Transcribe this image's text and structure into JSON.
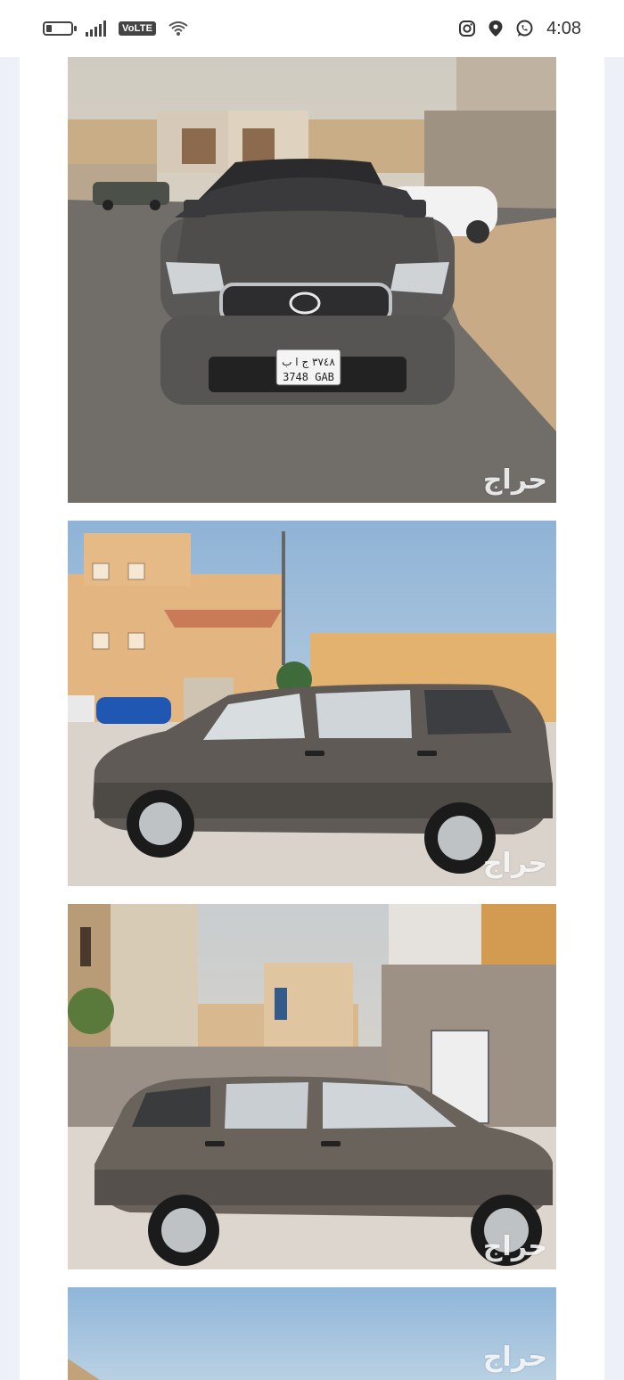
{
  "status_bar": {
    "network_badge": "VoLTE",
    "time": "4:08",
    "icons": [
      "battery-icon",
      "signal-icon",
      "wifi-icon",
      "instagram-icon",
      "location-icon",
      "whatsapp-icon"
    ]
  },
  "listing": {
    "photos": [
      {
        "name": "front-view",
        "watermark": "حراج",
        "plate_arabic": "٣٧٤٨ ج ا ب",
        "plate_latin": "3748 GAB"
      },
      {
        "name": "side-view-left",
        "watermark": "حراج"
      },
      {
        "name": "side-view-right",
        "watermark": "حراج"
      },
      {
        "name": "partial-view",
        "watermark": "حراج"
      }
    ]
  },
  "colors": {
    "page_bg": "#eef0f8",
    "card_bg": "#ffffff",
    "car_body": "#5e5a55"
  }
}
